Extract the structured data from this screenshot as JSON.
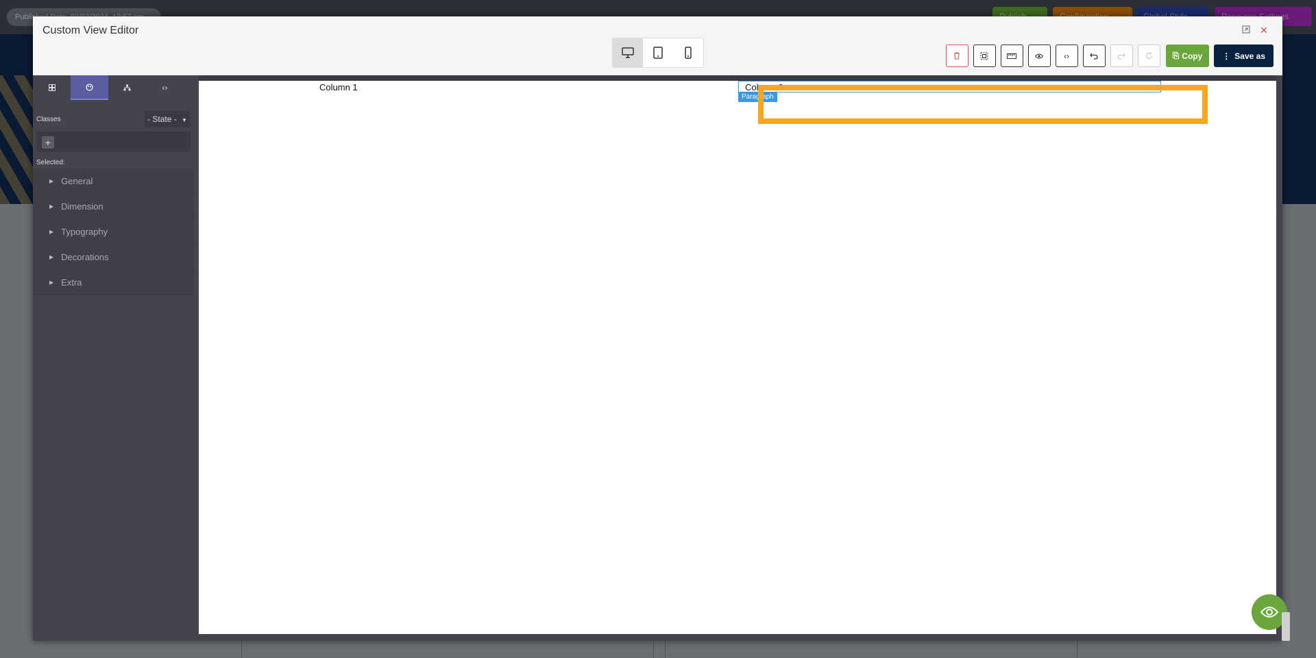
{
  "background": {
    "published_pill": "Published Date: 02/02/2024, 12:57 am",
    "buttons": [
      {
        "label": "Publish",
        "color": "#3d6b1e"
      },
      {
        "label": "Configuration",
        "color": "#8a4d05"
      },
      {
        "label": "Global Style",
        "color": "#1a2a6b"
      },
      {
        "label": "Resource Settings",
        "color": "#6a1a7a"
      }
    ]
  },
  "modal": {
    "title": "Custom View Editor",
    "icons": {
      "expand": "expand-icon",
      "close": "close-icon"
    }
  },
  "devices": [
    {
      "name": "desktop-icon",
      "active": true
    },
    {
      "name": "tablet-icon",
      "active": false
    },
    {
      "name": "mobile-icon",
      "active": false
    }
  ],
  "toolbar": {
    "buttons": [
      "trash-icon",
      "select-icon",
      "ruler-icon",
      "eye-icon",
      "code-icon",
      "undo-icon",
      "redo-icon",
      "refresh-icon"
    ],
    "copy_label": "Copy",
    "save_label": "Save as",
    "colors": {
      "copy": "#6aa63b",
      "save": "#0a2240",
      "delete": "#d9534f"
    }
  },
  "panel": {
    "tabs": [
      "blocks-icon",
      "style-manager-icon",
      "layers-icon",
      "code-icon"
    ],
    "classes_label": "Classes",
    "state_label": "- State -",
    "add_label": "+",
    "selected_label": "Selected:",
    "sectors": [
      "General",
      "Dimension",
      "Typography",
      "Decorations",
      "Extra"
    ]
  },
  "canvas": {
    "column1": "Column 1",
    "column2": "Column 2",
    "badge": "Paragraph"
  },
  "colors": {
    "highlight": "#f5a623",
    "selection": "#3b97e3",
    "fab": "#6aa63b"
  }
}
